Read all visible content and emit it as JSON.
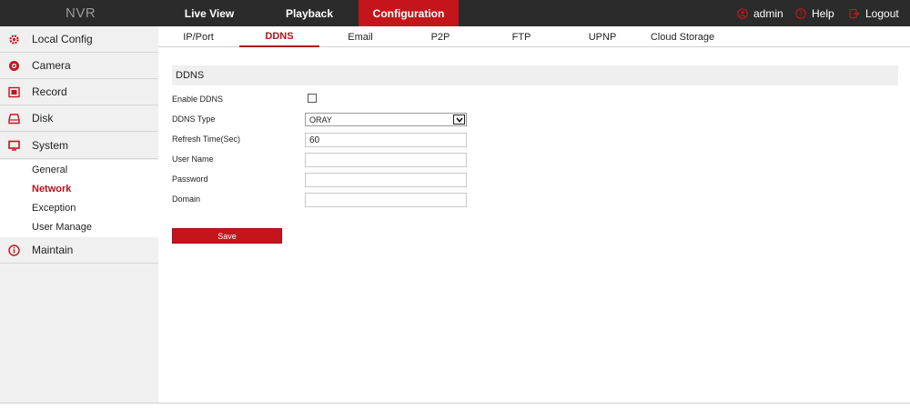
{
  "topbar": {
    "brand": "NVR",
    "nav": [
      "Live View",
      "Playback",
      "Configuration"
    ],
    "user": "admin",
    "help": "Help",
    "logout": "Logout"
  },
  "sidebar": {
    "items": [
      {
        "label": "Local Config",
        "icon": "gear-icon"
      },
      {
        "label": "Camera",
        "icon": "camera-icon"
      },
      {
        "label": "Record",
        "icon": "record-icon"
      },
      {
        "label": "Disk",
        "icon": "disk-icon"
      },
      {
        "label": "System",
        "icon": "monitor-icon"
      },
      {
        "label": "Maintain",
        "icon": "info-icon"
      }
    ],
    "sub_items": [
      "General",
      "Network",
      "Exception",
      "User Manage"
    ],
    "active_sub": "Network"
  },
  "tabs": [
    "IP/Port",
    "DDNS",
    "Email",
    "P2P",
    "FTP",
    "UPNP",
    "Cloud Storage"
  ],
  "active_tab": "DDNS",
  "section_title": "DDNS",
  "form": {
    "enable_ddns_label": "Enable DDNS",
    "enable_ddns_checked": false,
    "ddns_type_label": "DDNS Type",
    "ddns_type_value": "ORAY",
    "refresh_label": "Refresh Time(Sec)",
    "refresh_value": "60",
    "username_label": "User Name",
    "username_value": "",
    "password_label": "Password",
    "password_value": "",
    "domain_label": "Domain",
    "domain_value": ""
  },
  "save_label": "Save",
  "colors": {
    "accent": "#c4151c",
    "topbar": "#2b2b2b",
    "sidebar": "#f0f0f0"
  }
}
